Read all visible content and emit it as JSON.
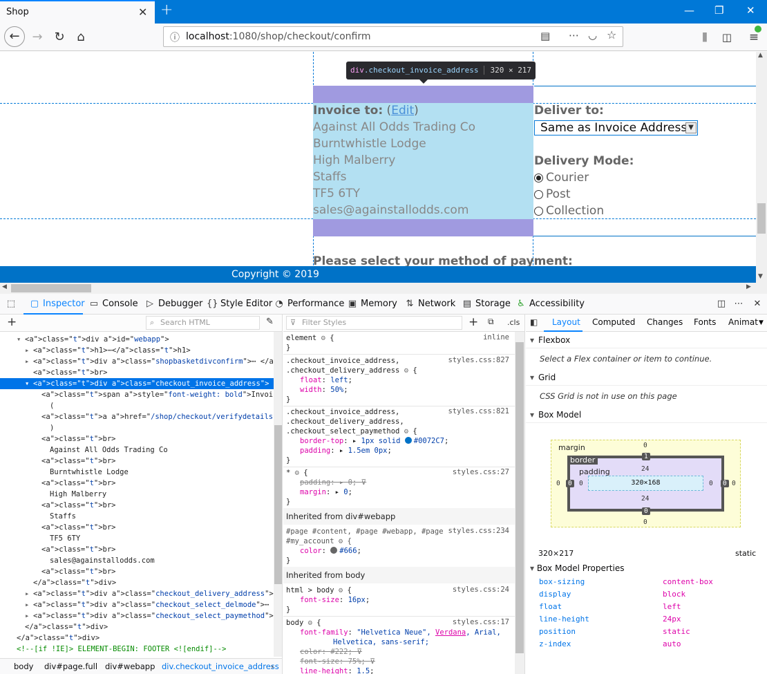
{
  "browser": {
    "tab_title": "Shop",
    "url_host": "localhost",
    "url_path": ":1080/shop/checkout/confirm"
  },
  "page": {
    "tooltip": {
      "tag": "div",
      "cls": ".checkout_invoice_address",
      "dims": "320 × 217"
    },
    "invoice_label": "Invoice to:",
    "edit_open": " (",
    "edit_link": "Edit",
    "edit_close": ")",
    "invoice_lines": [
      "Against All Odds Trading Co",
      "Burntwhistle Lodge",
      "High Malberry",
      "Staffs",
      "TF5 6TY",
      "sales@againstallodds.com"
    ],
    "deliver_label": "Deliver to:",
    "deliver_select": "Same as Invoice Address",
    "delivery_mode_label": "Delivery Mode:",
    "delivery_modes": [
      "Courier",
      "Post",
      "Collection"
    ],
    "payment_heading": "Please select your method of payment:",
    "copyright": "Copyright © 2019"
  },
  "devtools": {
    "tabs": [
      "Inspector",
      "Console",
      "Debugger",
      "Style Editor",
      "Performance",
      "Memory",
      "Network",
      "Storage",
      "Accessibility"
    ],
    "search_html_placeholder": "Search HTML",
    "filter_styles_placeholder": "Filter Styles",
    "cls_label": ".cls",
    "breadcrumbs": [
      "body",
      "div#page.full",
      "div#webapp",
      "div.checkout_invoice_address"
    ],
    "layout_tabs": [
      "Layout",
      "Computed",
      "Changes",
      "Fonts",
      "Animat"
    ],
    "flexbox_label": "Flexbox",
    "flexbox_msg": "Select a Flex container or item to continue.",
    "grid_label": "Grid",
    "grid_msg": "CSS Grid is not in use on this page",
    "boxmodel_label": "Box Model",
    "bm": {
      "margin_label": "margin",
      "border_label": "border",
      "padding_label": "padding",
      "content": "320×168",
      "margin": "0",
      "border": "1",
      "border_side": "0",
      "padding_tb": "24",
      "padding_lr": "0"
    },
    "bm_size": "320×217",
    "bm_position": "static",
    "bm_props_label": "Box Model Properties",
    "bm_props": [
      {
        "name": "box-sizing",
        "value": "content-box"
      },
      {
        "name": "display",
        "value": "block"
      },
      {
        "name": "float",
        "value": "left"
      },
      {
        "name": "line-height",
        "value": "24px"
      },
      {
        "name": "position",
        "value": "static"
      },
      {
        "name": "z-index",
        "value": "auto"
      }
    ],
    "rules": {
      "element_sel": "element",
      "element_src": "inline",
      "r1_sel1": ".checkout_invoice_address,",
      "r1_sel2": ".checkout_delivery_address",
      "r1_src": "styles.css:827",
      "r1_p1": "float",
      "r1_v1": "left",
      "r1_p2": "width",
      "r1_v2": "50%",
      "r2_sel1": ".checkout_invoice_address,",
      "r2_sel2": ".checkout_delivery_address,",
      "r2_sel3": ".checkout_select_paymethod",
      "r2_src": "styles.css:821",
      "r2_p1": "border-top",
      "r2_v1": "1px solid",
      "r2_color": "#0072C7",
      "r2_p2": "padding",
      "r2_v2": "1.5em 0px",
      "r3_sel": "*",
      "r3_src": "styles.css:27",
      "r3_p1": "padding",
      "r3_v1": "0",
      "r3_p2": "margin",
      "r3_v2": "0",
      "inh1": "Inherited from div#webapp",
      "r4_sel1": "#page #content, #page #webapp, #page",
      "r4_sel2": "#my_account",
      "r4_src": "styles.css:234",
      "r4_p1": "color",
      "r4_v1": "#666",
      "inh2": "Inherited from body",
      "r5_sel": "html > body",
      "r5_src": "styles.css:24",
      "r5_p1": "font-size",
      "r5_v1": "16px",
      "r6_sel": "body",
      "r6_src": "styles.css:17",
      "r6_p1": "font-family",
      "r6_v1a": "\"Helvetica Neue\",",
      "r6_v1b": "Verdana",
      "r6_v1c": ", Arial,",
      "r6_v1d": "Helvetica, sans-serif;",
      "r6_p2": "color",
      "r6_v2": "#222",
      "r6_p3": "font-size",
      "r6_v3": "75%",
      "r6_p4": "line-height",
      "r6_v4": "1.5"
    },
    "markup": [
      {
        "kind": "open",
        "text_tag": "<div ",
        "attr": "id=",
        "val": "\"webapp\"",
        "end": ">"
      },
      {
        "kind": "line",
        "raw": "<h1>⋯</h1>"
      },
      {
        "kind": "line",
        "raw": "<div class=\"shopbasketdivconfirm\">⋯ </div>"
      },
      {
        "kind": "line",
        "raw": "<br>"
      },
      {
        "kind": "sel",
        "raw": "<div class=\"checkout_invoice_address\">"
      },
      {
        "kind": "line",
        "raw": "<span style=\"font-weight: bold\">Invoice to:</span>"
      },
      {
        "kind": "text",
        "raw": "("
      },
      {
        "kind": "line",
        "raw": "<a href=\"/shop/checkout/verifydetails\">Edit</a>"
      },
      {
        "kind": "text",
        "raw": ")"
      },
      {
        "kind": "line",
        "raw": "<br>"
      },
      {
        "kind": "text",
        "raw": "Against All Odds Trading Co"
      },
      {
        "kind": "line",
        "raw": "<br>"
      },
      {
        "kind": "text",
        "raw": "Burntwhistle Lodge"
      },
      {
        "kind": "line",
        "raw": "<br>"
      },
      {
        "kind": "text",
        "raw": "High Malberry"
      },
      {
        "kind": "line",
        "raw": "<br>"
      },
      {
        "kind": "text",
        "raw": "Staffs"
      },
      {
        "kind": "line",
        "raw": "<br>"
      },
      {
        "kind": "text",
        "raw": "TF5 6TY"
      },
      {
        "kind": "line",
        "raw": "<br>"
      },
      {
        "kind": "text",
        "raw": "sales@againstallodds.com"
      },
      {
        "kind": "line",
        "raw": "<br>"
      },
      {
        "kind": "line",
        "raw": "</div>"
      },
      {
        "kind": "line",
        "raw": "<div class=\"checkout_delivery_address\">⋯ </div>"
      },
      {
        "kind": "line",
        "raw": "<div class=\"checkout_select_delmode\">⋯ </div>"
      },
      {
        "kind": "line",
        "raw": "<div class=\"checkout_select_paymethod\">⋯ </div>"
      },
      {
        "kind": "line",
        "raw": "</div>"
      },
      {
        "kind": "line",
        "raw": "</div>"
      },
      {
        "kind": "comment",
        "raw": "<!--[if !IE]> ELEMENT-BEGIN: FOOTER <![endif]-->"
      }
    ]
  }
}
